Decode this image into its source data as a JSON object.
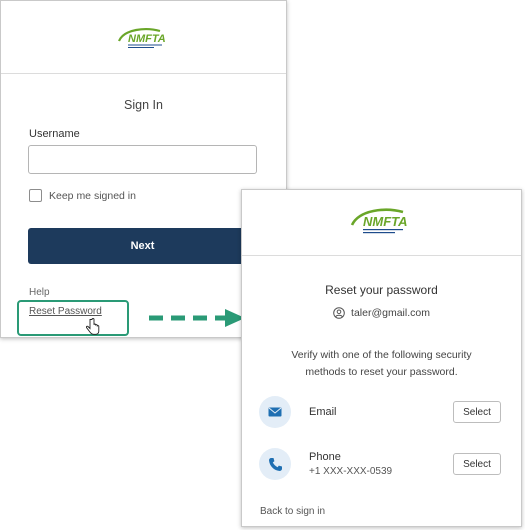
{
  "logo": {
    "text": "NMFTA",
    "tagline": "National Motor Freight Traffic Association, Inc."
  },
  "signin": {
    "title": "Sign In",
    "username_label": "Username",
    "username_value": "",
    "keep_signed_in_label": "Keep me signed in",
    "next_label": "Next",
    "help_label": "Help",
    "reset_link": "Reset Password"
  },
  "reset": {
    "title": "Reset your password",
    "email": "taler@gmail.com",
    "description": "Verify with one of the following security methods to reset your password.",
    "methods": [
      {
        "name": "Email",
        "sub": "",
        "select_label": "Select",
        "icon": "envelope-icon"
      },
      {
        "name": "Phone",
        "sub": "+1 XXX-XXX-0539",
        "select_label": "Select",
        "icon": "phone-icon"
      }
    ],
    "back_label": "Back to sign in"
  },
  "colors": {
    "primary_button": "#1d3a5c",
    "highlight": "#2a9a76",
    "logo_green": "#6aa629",
    "logo_blue": "#1e4c8c"
  }
}
